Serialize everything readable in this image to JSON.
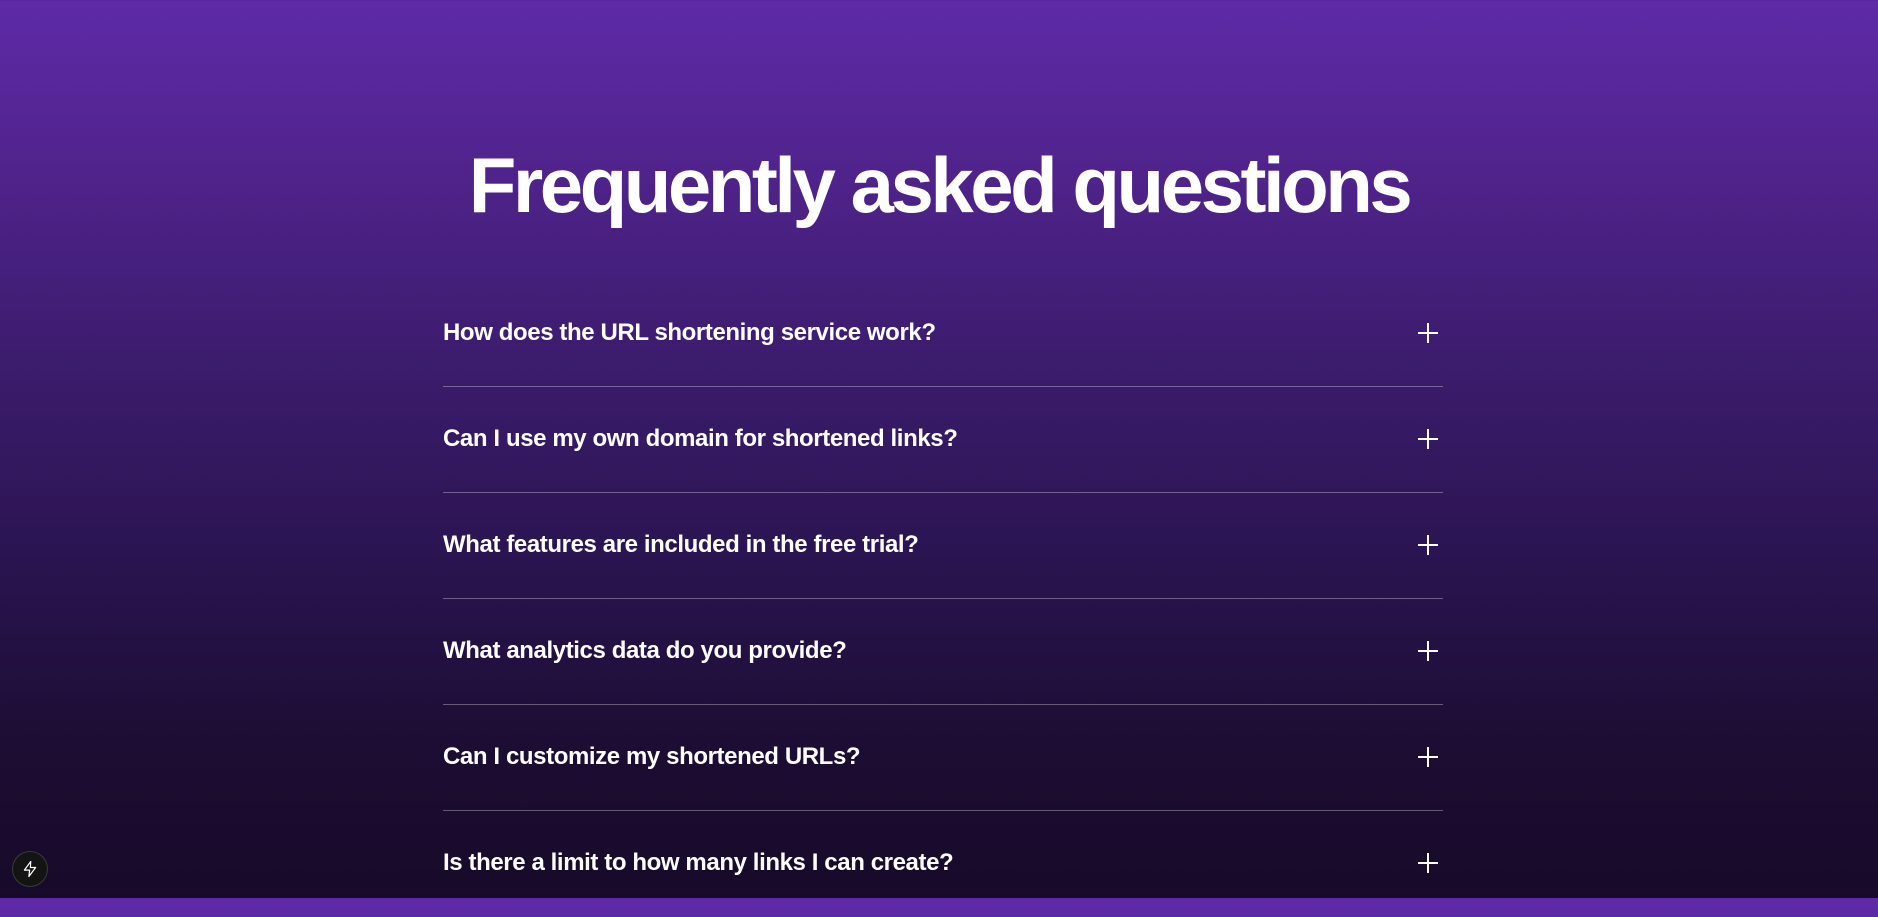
{
  "faq": {
    "title": "Frequently asked questions",
    "items": [
      {
        "question": "How does the URL shortening service work?",
        "expanded": false
      },
      {
        "question": "Can I use my own domain for shortened links?",
        "expanded": false
      },
      {
        "question": "What features are included in the free trial?",
        "expanded": false
      },
      {
        "question": "What analytics data do you provide?",
        "expanded": false
      },
      {
        "question": "Can I customize my shortened URLs?",
        "expanded": false
      },
      {
        "question": "Is there a limit to how many links I can create?",
        "expanded": false
      }
    ],
    "toggle_icon": "plus-icon"
  },
  "devtools": {
    "icon": "lightning-bolt-icon"
  },
  "colors": {
    "gradient_top": "#5e2aa8",
    "gradient_bottom": "#170a29",
    "text": "#ffffff",
    "divider": "rgba(255,255,255,0.32)"
  }
}
